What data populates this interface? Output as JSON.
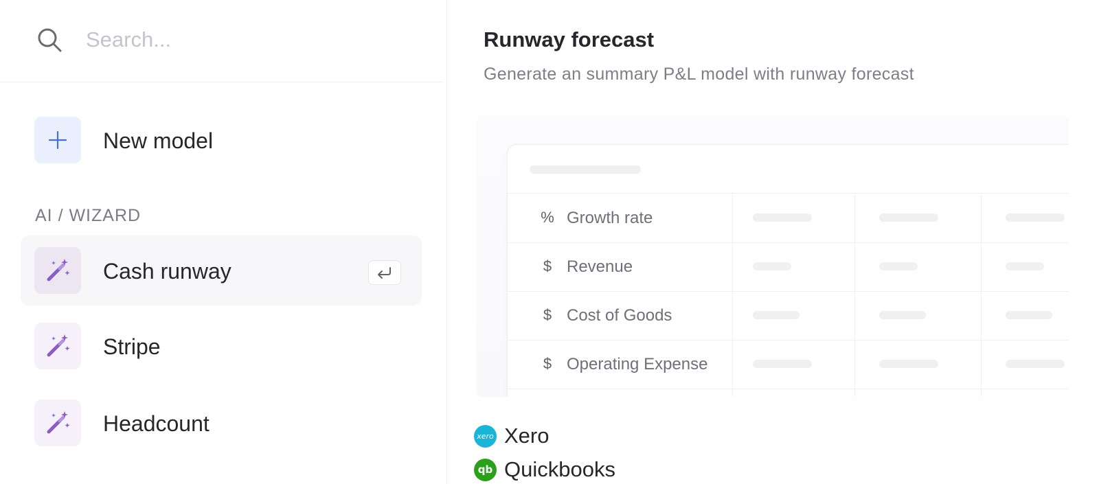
{
  "search": {
    "placeholder": "Search...",
    "icon": "search-icon"
  },
  "new_model": {
    "label": "New model",
    "icon": "plus-icon"
  },
  "sections": {
    "ai_wizard_title": "AI / WIZARD"
  },
  "wizard_items": [
    {
      "label": "Cash runway",
      "icon": "magic-wand-icon",
      "selected": true,
      "shortcut_icon": "enter-key-icon"
    },
    {
      "label": "Stripe",
      "icon": "magic-wand-icon",
      "selected": false
    },
    {
      "label": "Headcount",
      "icon": "magic-wand-icon",
      "selected": false
    }
  ],
  "detail": {
    "title": "Runway forecast",
    "description": "Generate an summary P&L model with runway forecast",
    "table_rows": [
      {
        "symbol": "%",
        "label": "Growth rate"
      },
      {
        "symbol": "$",
        "label": "Revenue"
      },
      {
        "symbol": "$",
        "label": "Cost of Goods"
      },
      {
        "symbol": "$",
        "label": "Operating Expense"
      }
    ],
    "integrations": [
      {
        "name": "Xero",
        "logo_text": "xero",
        "color": "#1ab4d7",
        "icon": "xero-logo-icon"
      },
      {
        "name": "Quickbooks",
        "logo_text": "qb",
        "color": "#2ca01c",
        "icon": "quickbooks-logo-icon"
      }
    ]
  },
  "colors": {
    "accent_blue": "#4a6fd4",
    "wand_purple": "#8a5cc4",
    "selected_row_bg": "#f7f7fa"
  }
}
